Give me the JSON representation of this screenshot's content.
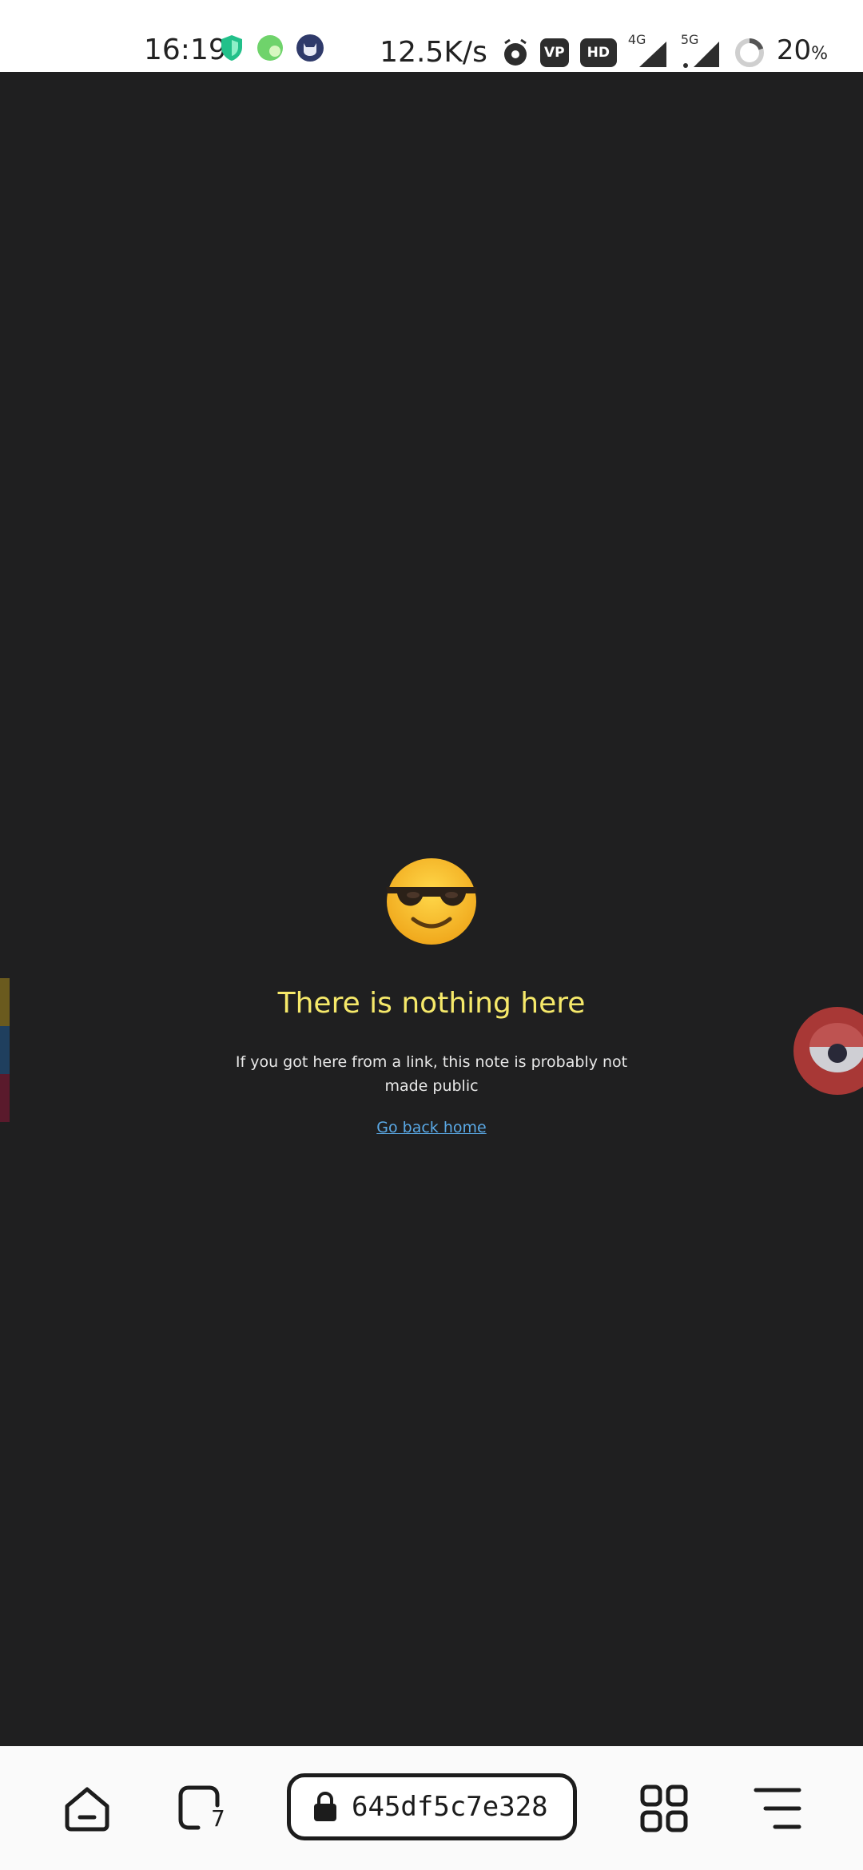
{
  "status_bar": {
    "time": "16:19",
    "net_speed": "12.5K/s",
    "hd_label": "HD",
    "vp_label": "VP",
    "signal1_label": "4G",
    "signal2_label": "5G",
    "battery_pct": "20",
    "battery_unit": "%"
  },
  "page": {
    "title": "There is nothing here",
    "description": "If you got here from a link, this note is probably not made public",
    "home_link": "Go back home"
  },
  "browser": {
    "url": "645df5c7e328",
    "tabs_count": "7"
  },
  "colors": {
    "background": "#1f1f20",
    "title": "#f6e96a",
    "link": "#5aa9e6",
    "float_button": "#b03a38"
  }
}
